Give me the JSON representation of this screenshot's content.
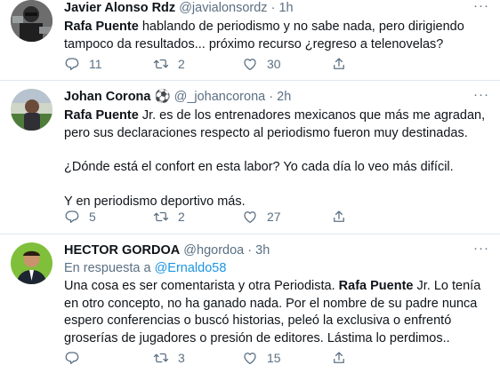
{
  "tweets": [
    {
      "name": "Javier Alonso Rdz",
      "handle": "@javialonsordz",
      "sep": "·",
      "time": "1h",
      "more": "···",
      "text_parts": {
        "bold": "Rafa Puente",
        "rest": " hablando de periodismo y no sabe nada, pero dirigiendo tampoco da resultados... próximo recurso ¿regreso a telenovelas?"
      },
      "replies": "11",
      "retweets": "2",
      "likes": "30"
    },
    {
      "name": "Johan Corona",
      "name_emoji": "⚽",
      "handle": "@_johancorona",
      "sep": "·",
      "time": "2h",
      "more": "···",
      "p1_bold": "Rafa Puente",
      "p1_rest": " Jr. es de los entrenadores mexicanos que más me agradan, pero sus declaraciones respecto al periodismo fueron muy destinadas.",
      "p2": "¿Dónde está el confort en esta labor? Yo cada día lo veo más difícil.",
      "p3": "Y en periodismo deportivo más.",
      "replies": "5",
      "retweets": "2",
      "likes": "27"
    },
    {
      "name": "HECTOR GORDOA",
      "handle": "@hgordoa",
      "sep": "·",
      "time": "3h",
      "more": "···",
      "reply_prefix": "En respuesta a ",
      "reply_mention": "@Ernaldo58",
      "text_before": "Una cosa es ser comentarista y otra Periodista. ",
      "text_bold": "Rafa Puente",
      "text_after": " Jr. Lo tenía en otro concepto, no ha ganado nada. Por el nombre de su padre nunca espero conferencias o buscó historias, peleó la exclusiva o enfrentó groserías de jugadores o presión de editores. Lástima lo perdimos..",
      "replies": "",
      "retweets": "3",
      "likes": "15"
    }
  ],
  "icons": [
    "reply-icon",
    "retweet-icon",
    "like-icon",
    "share-icon",
    "more-icon"
  ],
  "colors": {
    "secondary_text": "#5b7083",
    "link": "#1b95e0",
    "divider": "#e1e8ed"
  }
}
